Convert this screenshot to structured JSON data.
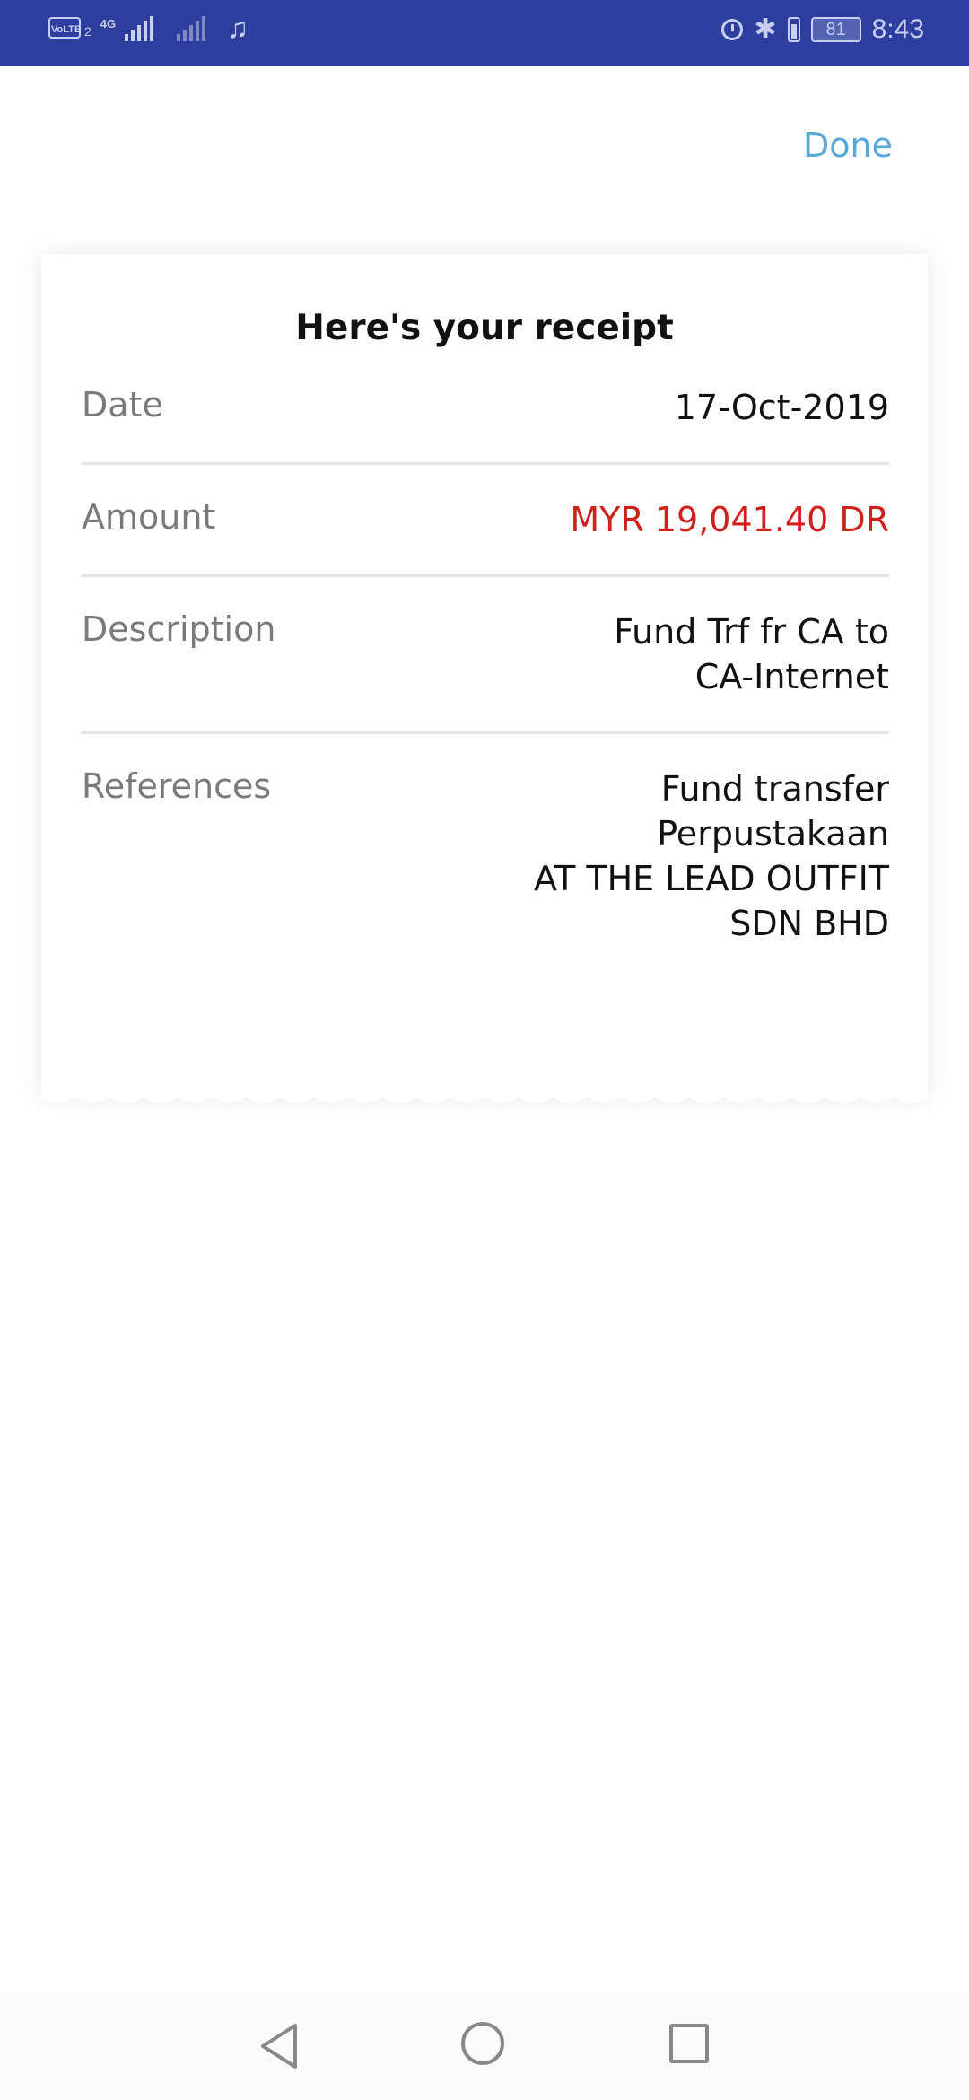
{
  "status_bar": {
    "volte": "VoLTE",
    "sim": "2",
    "network": "4G",
    "battery": "81",
    "time": "8:43",
    "icons": [
      "signal-icon",
      "signal-icon",
      "music-icon",
      "alarm-icon",
      "bluetooth-icon",
      "battery-icon"
    ]
  },
  "header": {
    "done_label": "Done",
    "done_color": "#5aa8d6"
  },
  "receipt": {
    "title": "Here's your receipt",
    "date_label": "Date",
    "date_value": "17-Oct-2019",
    "amount_label": "Amount",
    "amount_value": "MYR 19,041.40 DR",
    "amount_color": "#d0201c",
    "description_label": "Description",
    "description_value": "Fund Trf fr CA to\nCA-Internet",
    "references_label": "References",
    "references_value": "Fund transfer\nPerpustakaan\nAT THE LEAD OUTFIT\nSDN BHD"
  },
  "nav_bar": {
    "buttons": [
      "back-icon",
      "home-icon",
      "recent-apps-icon"
    ]
  }
}
